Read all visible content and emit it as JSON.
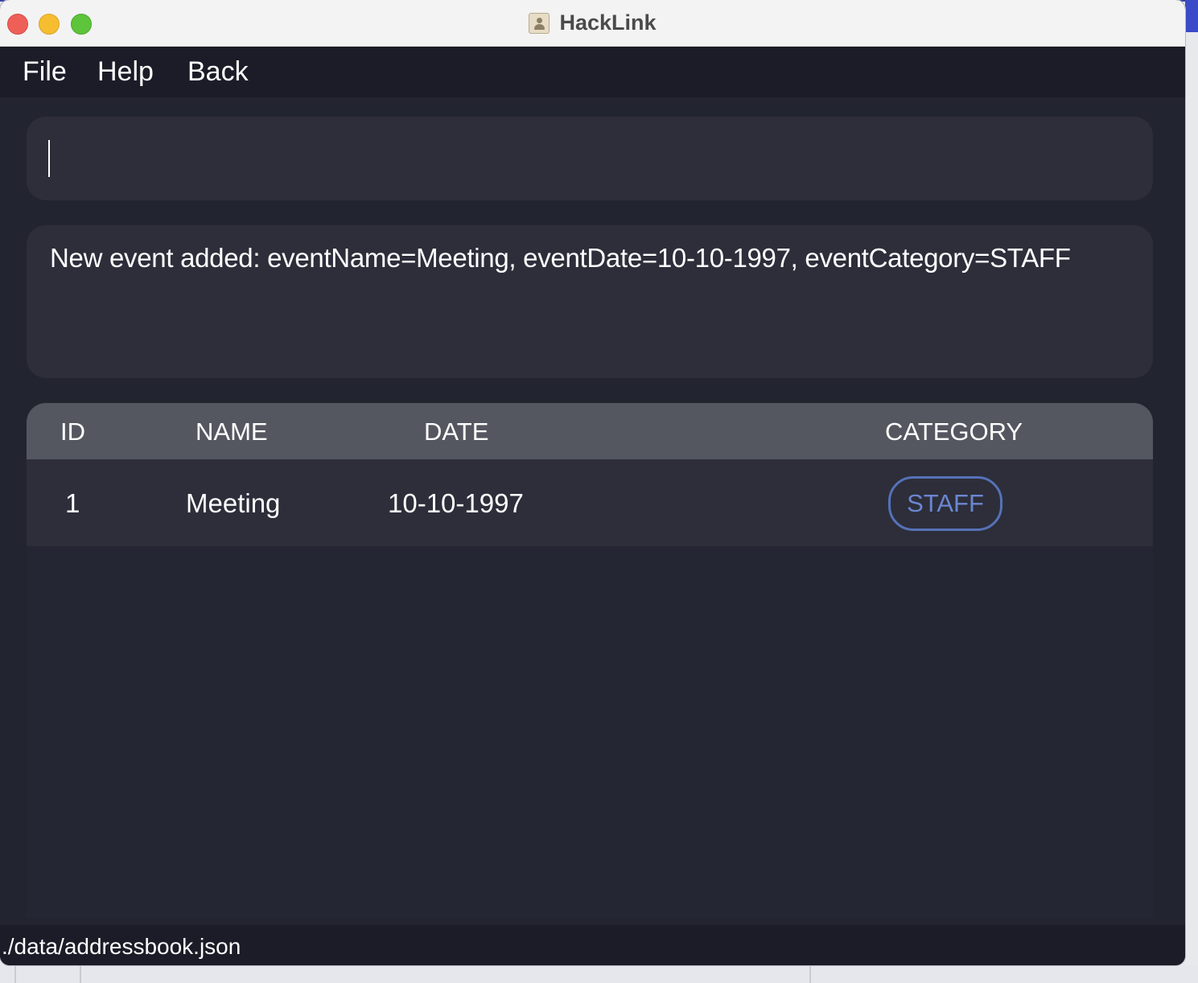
{
  "window": {
    "title": "HackLink"
  },
  "menu": {
    "file": "File",
    "help": "Help",
    "back": "Back"
  },
  "command": {
    "value": ""
  },
  "result": {
    "message": "New event added: eventName=Meeting, eventDate=10-10-1997, eventCategory=STAFF"
  },
  "table": {
    "headers": {
      "id": "ID",
      "name": "NAME",
      "date": "DATE",
      "category": "CATEGORY"
    },
    "rows": [
      {
        "id": "1",
        "name": "Meeting",
        "date": "10-10-1997",
        "category": "STAFF"
      }
    ]
  },
  "status": {
    "path": "./data/addressbook.json"
  },
  "colors": {
    "background": "#22242f",
    "panel": "#2d2e3a",
    "header": "#555760",
    "menubar": "#1b1c27",
    "tag_border": "#5671b8",
    "tag_text": "#6b86d0"
  }
}
